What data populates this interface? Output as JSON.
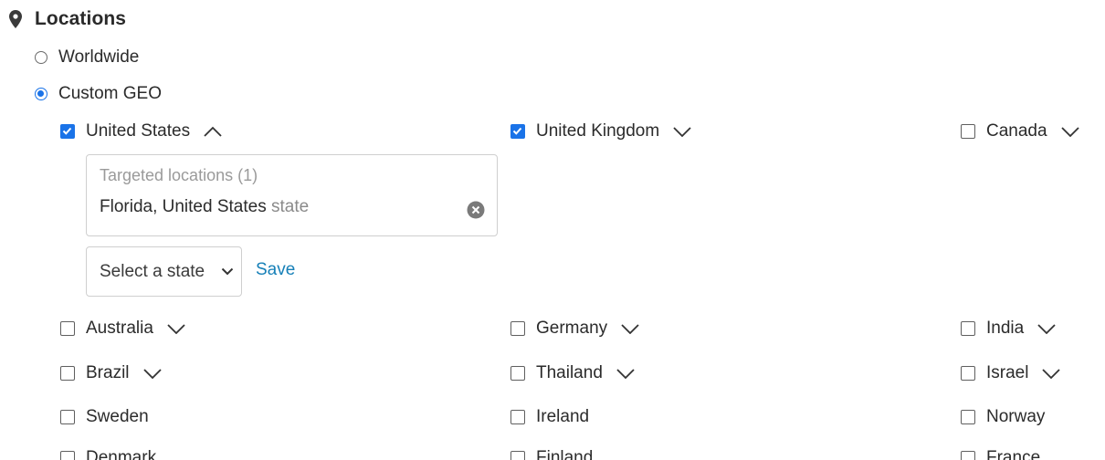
{
  "section": {
    "title": "Locations",
    "icon": "map-pin-icon"
  },
  "scope": {
    "worldwide_label": "Worldwide",
    "custom_label": "Custom GEO",
    "selected": "custom"
  },
  "countries": {
    "united_states": {
      "label": "United States",
      "checked": true,
      "expanded": true
    },
    "united_kingdom": {
      "label": "United Kingdom",
      "checked": true
    },
    "canada": {
      "label": "Canada",
      "checked": false
    },
    "australia": {
      "label": "Australia",
      "checked": false
    },
    "germany": {
      "label": "Germany",
      "checked": false
    },
    "india": {
      "label": "India",
      "checked": false
    },
    "brazil": {
      "label": "Brazil",
      "checked": false
    },
    "thailand": {
      "label": "Thailand",
      "checked": false
    },
    "israel": {
      "label": "Israel",
      "checked": false
    },
    "sweden": {
      "label": "Sweden",
      "checked": false
    },
    "ireland": {
      "label": "Ireland",
      "checked": false
    },
    "norway": {
      "label": "Norway",
      "checked": false
    },
    "denmark": {
      "label": "Denmark",
      "checked": false
    },
    "finland": {
      "label": "Finland",
      "checked": false
    },
    "france": {
      "label": "France",
      "checked": false
    }
  },
  "targeted": {
    "label": "Targeted locations (1)",
    "item_name": "Florida, United States",
    "item_type": "state"
  },
  "state_select": {
    "value": "Select a state"
  },
  "save_label": "Save",
  "colors": {
    "accent": "#1a73e8",
    "link": "#1780b8"
  }
}
